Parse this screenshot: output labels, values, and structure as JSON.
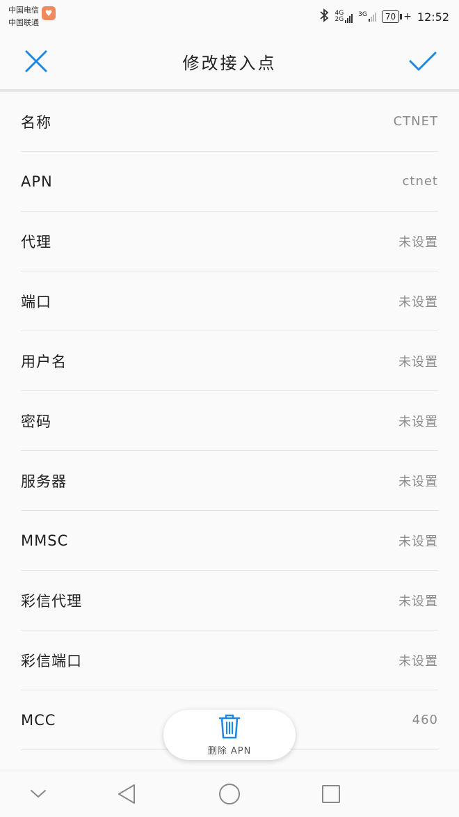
{
  "status_bar": {
    "carrier_1": "中国电信",
    "carrier_2": "中国联通",
    "network_1_top": "4G",
    "network_1_bottom": "2G",
    "network_2": "3G",
    "battery_level": "70",
    "time": "12:52"
  },
  "header": {
    "title": "修改接入点"
  },
  "fields": [
    {
      "label": "名称",
      "value": "CTNET"
    },
    {
      "label": "APN",
      "value": "ctnet"
    },
    {
      "label": "代理",
      "value": "未设置"
    },
    {
      "label": "端口",
      "value": "未设置"
    },
    {
      "label": "用户名",
      "value": "未设置"
    },
    {
      "label": "密码",
      "value": "未设置"
    },
    {
      "label": "服务器",
      "value": "未设置"
    },
    {
      "label": "MMSC",
      "value": "未设置"
    },
    {
      "label": "彩信代理",
      "value": "未设置"
    },
    {
      "label": "彩信端口",
      "value": "未设置"
    },
    {
      "label": "MCC",
      "value": "460"
    }
  ],
  "delete_button": {
    "label": "删除 APN"
  },
  "colors": {
    "accent": "#1e88e5",
    "value_text": "#8a8a8a",
    "background": "#fafafa"
  }
}
